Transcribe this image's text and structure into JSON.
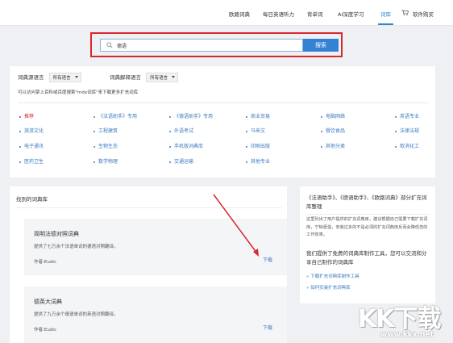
{
  "nav": {
    "items": [
      "欧路词典",
      "每日英语听力",
      "背单词",
      "AI深度学习",
      "词库",
      "软件购买"
    ],
    "active_index": 4
  },
  "search": {
    "value": "德语",
    "button_label": "搜索",
    "highlight_color": "#d8282e"
  },
  "filters": {
    "source_label": "词典源语言",
    "source_value": "所有语言",
    "target_label": "词典解释语言",
    "target_value": "所有语言",
    "hint": "可以访问掌上百科或百度搜索\"mdx词库\"来下载更多扩充词库"
  },
  "categories": [
    [
      "推荐",
      "《法语助手》专用",
      "《德语助手》专用",
      "商业贸易",
      "电脑网络",
      "英语专业"
    ],
    [
      "旅游文化",
      "工程建筑",
      "外语考试",
      "马来文",
      "餐饮食品",
      "法律法规"
    ],
    [
      "电子通讯",
      "生物生态",
      "手机版词典库",
      "印刷出版",
      "其他分类",
      "取消化工"
    ],
    [
      "医药卫生",
      "数学物理",
      "交通运输",
      "其他专业"
    ]
  ],
  "results": {
    "title": "找到的词典库",
    "items": [
      {
        "name": "简明法德对照词典",
        "desc": "提供了七万余个法语单词的德语对照翻译。",
        "author": "作者:Eudic",
        "download": "下载"
      },
      {
        "name": "德英大词典",
        "desc": "提供了九万余个德语单词的英语对照翻译。",
        "author": "作者:Eudic",
        "download": "下载"
      }
    ]
  },
  "side": {
    "title": "《法语助手》、《德语助手》、《欧路词典》部分扩充词库整理",
    "body": "这里列出了用户提供的扩充词典库，建议根据自己需要下载扩充词库，宁缺毋滥，安装过多的不是必须的扩充词典库反而会降低您的工作效率。",
    "subtitle": "我们提供了免费的词典库制作工具，您可以交流和分享自己制作的词典库",
    "links": [
      "» 下载扩充词典库制作工具",
      "» 如何安装扩充词典库"
    ]
  },
  "watermark": {
    "logo": "KK下载",
    "url": "www.kkx.net"
  },
  "colors": {
    "accent": "#2f86d6",
    "button": "#3582d4",
    "link": "#3a7abf",
    "active_category": "#d8282e"
  }
}
